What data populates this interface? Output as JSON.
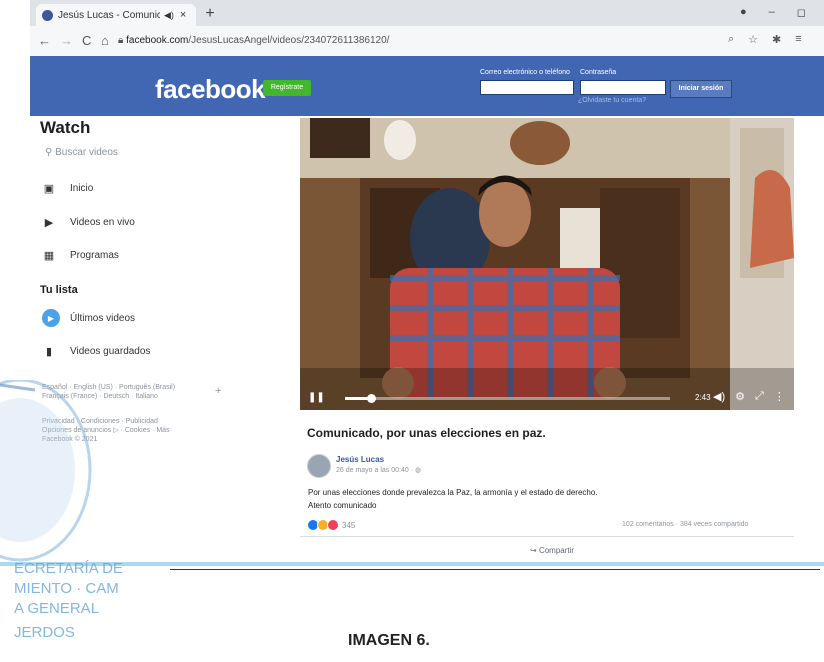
{
  "browser": {
    "tab_title": "Jesús Lucas - Comunicado, p",
    "tab_audio_icon": "speaker-icon",
    "tab_close": "×",
    "new_tab": "+",
    "url_domain": "facebook.com",
    "url_path": "/JesusLucasAngel/videos/234072611386120/"
  },
  "facebook": {
    "logo": "facebook",
    "register_label": "Regístrate",
    "email_label": "Correo electrónico o teléfono",
    "password_label": "Contraseña",
    "login_label": "Iniciar sesión",
    "forgot_label": "¿Olvidaste tu cuenta?"
  },
  "sidebar": {
    "title": "Watch",
    "search_placeholder": "Buscar videos",
    "items": [
      {
        "label": "Inicio",
        "icon": "tv-icon"
      },
      {
        "label": "Videos en vivo",
        "icon": "live-camera-icon"
      },
      {
        "label": "Programas",
        "icon": "clapper-icon"
      }
    ],
    "list_title": "Tu lista",
    "list_items": [
      {
        "label": "Últimos videos",
        "icon": "play-circle-icon"
      },
      {
        "label": "Videos guardados",
        "icon": "bookmark-icon"
      }
    ],
    "languages_line1": "Español · English (US) · Português (Brasil)",
    "languages_line2": "Français (France) · Deutsch · Italiano",
    "add_language": "+",
    "footer_line1": "Privacidad · Condiciones · Publicidad",
    "footer_line2": "Opciones de anuncios ▷ · Cookies · Más",
    "footer_line3": "Facebook © 2021"
  },
  "video": {
    "time": "2:43",
    "progress": 0.08
  },
  "post": {
    "title": "Comunicado, por unas elecciones en paz.",
    "author": "Jesús Lucas",
    "date": "26 de mayo a las 00:40 · ",
    "text1": "Por unas elecciones donde prevalezca la Paz, la armonía y el estado de derecho.",
    "text2": "Atento comunicado",
    "reactions_count": "345",
    "comments_shares": "102 comentarios · 384 veces compartido",
    "share_label": "Compartir"
  },
  "stamp": {
    "line1": "ECRETARÍA DE",
    "line2": "MIENTO · CAM",
    "line3": "A GENERAL",
    "line4": "JERDOS"
  },
  "caption": "IMAGEN 6.",
  "colors": {
    "fb_blue": "#4267b2",
    "register_green": "#42b72a",
    "link_blue": "#385898"
  }
}
